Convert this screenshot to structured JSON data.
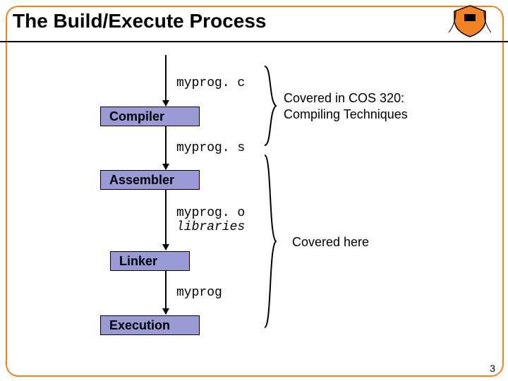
{
  "title": "The Build/Execute Process",
  "page_number": "3",
  "files": {
    "c": "myprog. c",
    "s": "myprog. s",
    "o": "myprog. o",
    "lib": "libraries",
    "exe": "myprog"
  },
  "stages": {
    "compiler": "Compiler",
    "assembler": "Assembler",
    "linker": "Linker",
    "execution": "Execution"
  },
  "notes": {
    "top": "Covered in COS 320:\nCompiling Techniques",
    "bottom": "Covered here"
  }
}
